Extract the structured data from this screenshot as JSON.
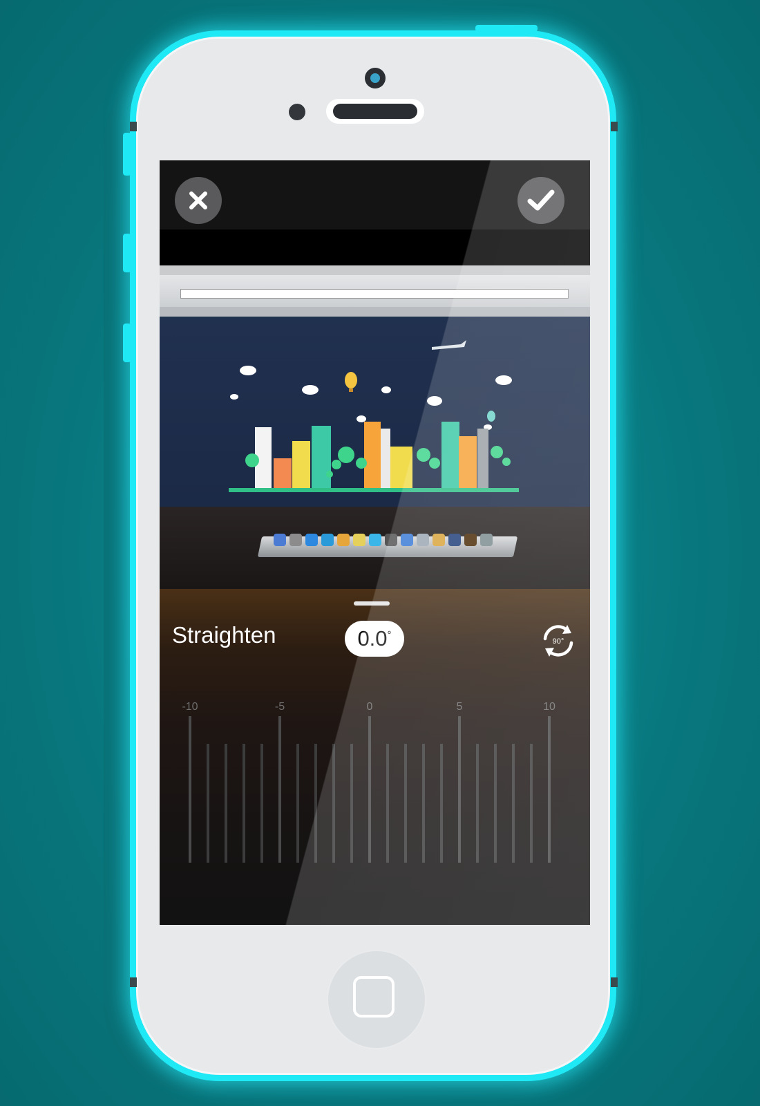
{
  "editor": {
    "cancel_icon": "close-icon",
    "confirm_icon": "checkmark-icon",
    "tool_title": "Straighten",
    "angle_value": "0.0",
    "angle_unit": "°",
    "rotate_label": "90°",
    "rotate_icon": "rotate-90-icon"
  },
  "ruler": {
    "labels": [
      "-10",
      "-5",
      "0",
      "5",
      "10"
    ],
    "min": -10,
    "max": 10,
    "current": 0
  },
  "colors": {
    "background": "#0b7f86",
    "phone_frame": "#1ee9f5",
    "panel_text": "#ffffff"
  }
}
